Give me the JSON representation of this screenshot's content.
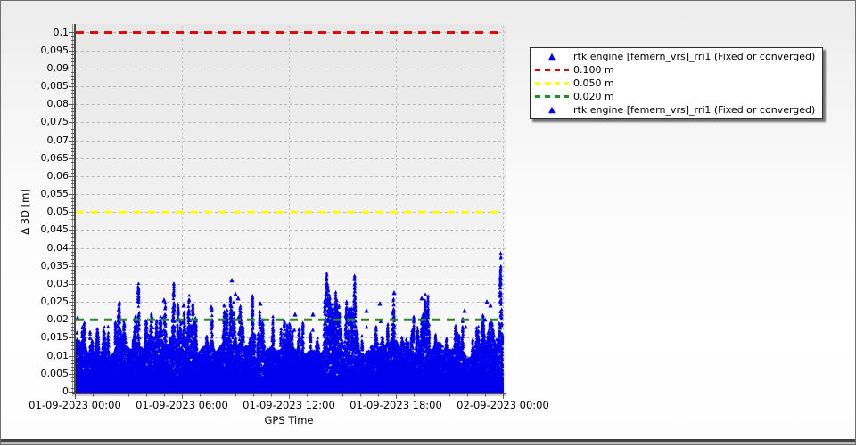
{
  "chart_data": {
    "type": "scatter",
    "title": "",
    "xlabel": "GPS Time",
    "ylabel": "Δ 3D [m]",
    "x_axis": {
      "tick_labels": [
        "01-09-2023 00:00",
        "01-09-2023 06:00",
        "01-09-2023 12:00",
        "01-09-2023 18:00",
        "02-09-2023 00:00"
      ],
      "tick_hours": [
        0,
        6,
        12,
        18,
        24
      ],
      "minor_tick_every_hours": 1,
      "range_hours": [
        0,
        24
      ]
    },
    "y_axis": {
      "tick_labels_top_down": [
        "0,1",
        "0,095",
        "0,09",
        "0,085",
        "0,08",
        "0,075",
        "0,07",
        "0,065",
        "0,06",
        "0,055",
        "0,05",
        "0,045",
        "0,04",
        "0,035",
        "0,03",
        "0,025",
        "0,02",
        "0,015",
        "0,01",
        "0,005",
        "0"
      ],
      "tick_step": 0.005,
      "minor_tick_step": 0.001,
      "range": [
        0,
        0.1
      ]
    },
    "grid": true,
    "series": [
      {
        "name": "rtk engine [femern_vrs]_rri1 (Fixed or converged)",
        "marker": "triangle-up",
        "color": "#0000ee",
        "description": "dense noise cloud of fixed/converged RTK 3D position deltas",
        "point_count_approx": 30000,
        "y_min": 0.0,
        "y_dense_band": [
          0.0,
          0.015
        ],
        "y_typical_spike_top": 0.02,
        "y_max": 0.031,
        "outliers_t_hours_y_m": [
          [
            0.15,
            0.0205
          ],
          [
            5.0,
            0.0255
          ],
          [
            6.1,
            0.024
          ],
          [
            7.65,
            0.0235
          ],
          [
            8.8,
            0.031
          ],
          [
            9.0,
            0.0272
          ],
          [
            9.15,
            0.026
          ],
          [
            10.4,
            0.0245
          ],
          [
            12.35,
            0.0215
          ],
          [
            13.35,
            0.0215
          ],
          [
            14.65,
            0.0215
          ],
          [
            16.35,
            0.0225
          ],
          [
            17.1,
            0.0245
          ],
          [
            17.9,
            0.0275
          ],
          [
            19.45,
            0.026
          ],
          [
            21.85,
            0.0225
          ],
          [
            23.1,
            0.025
          ],
          [
            23.3,
            0.024
          ]
        ]
      }
    ],
    "reference_lines": [
      {
        "label": "0.100 m",
        "value": 0.1,
        "color": "#ee0000"
      },
      {
        "label": "0.050 m",
        "value": 0.05,
        "color": "#ffff00"
      },
      {
        "label": "0.020 m",
        "value": 0.02,
        "color": "#1d8f1d"
      }
    ],
    "legend": {
      "position": "top-right",
      "entries": [
        {
          "swatch": "triangle",
          "color": "#0000ee",
          "label": "rtk engine [femern_vrs]_rri1 (Fixed or converged)"
        },
        {
          "swatch": "dashed-line",
          "color": "#ee0000",
          "label": "0.100 m"
        },
        {
          "swatch": "dashed-line",
          "color": "#ffff00",
          "label": "0.050 m"
        },
        {
          "swatch": "dashed-line",
          "color": "#1d8f1d",
          "label": "0.020 m"
        },
        {
          "swatch": "triangle",
          "color": "#0000ee",
          "label": "rtk engine [femern_vrs]_rri1 (Fixed or converged)"
        }
      ]
    },
    "colors": {
      "marker_blue": "#0000ee",
      "grid_gray": "#b5b5b5",
      "plot_bg_top": "#e7e7e7",
      "plot_bg_bottom": "#fcfcfc",
      "axis_dark": "#4a4a4a"
    }
  }
}
